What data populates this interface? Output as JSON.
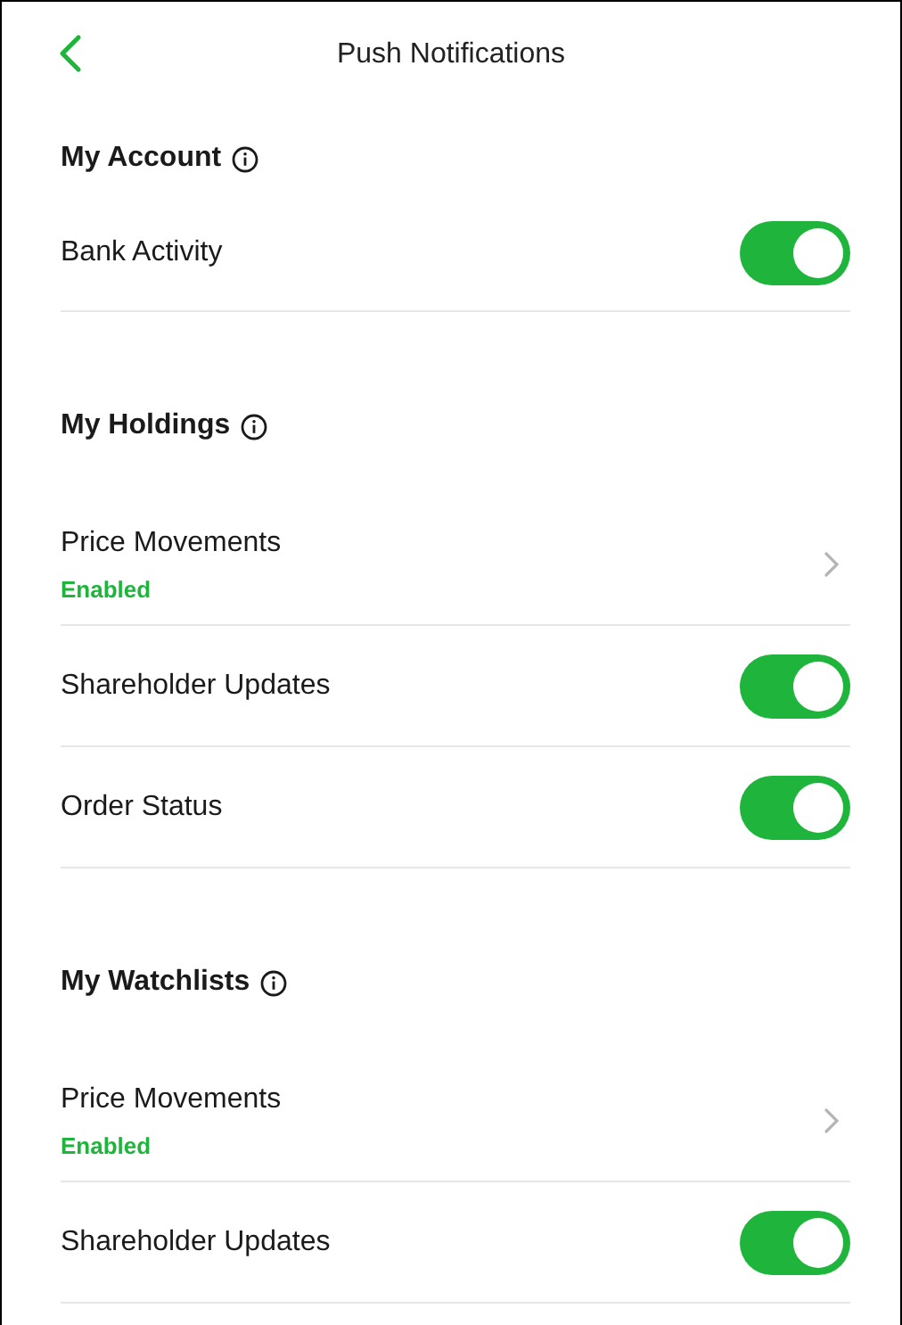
{
  "header": {
    "title": "Push Notifications"
  },
  "sections": [
    {
      "title": "My Account",
      "rows": [
        {
          "kind": "toggle",
          "label": "Bank Activity",
          "on": true
        }
      ]
    },
    {
      "title": "My Holdings",
      "rows": [
        {
          "kind": "link",
          "label": "Price Movements",
          "status": "Enabled"
        },
        {
          "kind": "toggle",
          "label": "Shareholder Updates",
          "on": true
        },
        {
          "kind": "toggle",
          "label": "Order Status",
          "on": true
        }
      ]
    },
    {
      "title": "My Watchlists",
      "rows": [
        {
          "kind": "link",
          "label": "Price Movements",
          "status": "Enabled"
        },
        {
          "kind": "toggle",
          "label": "Shareholder Updates",
          "on": true
        }
      ]
    }
  ]
}
